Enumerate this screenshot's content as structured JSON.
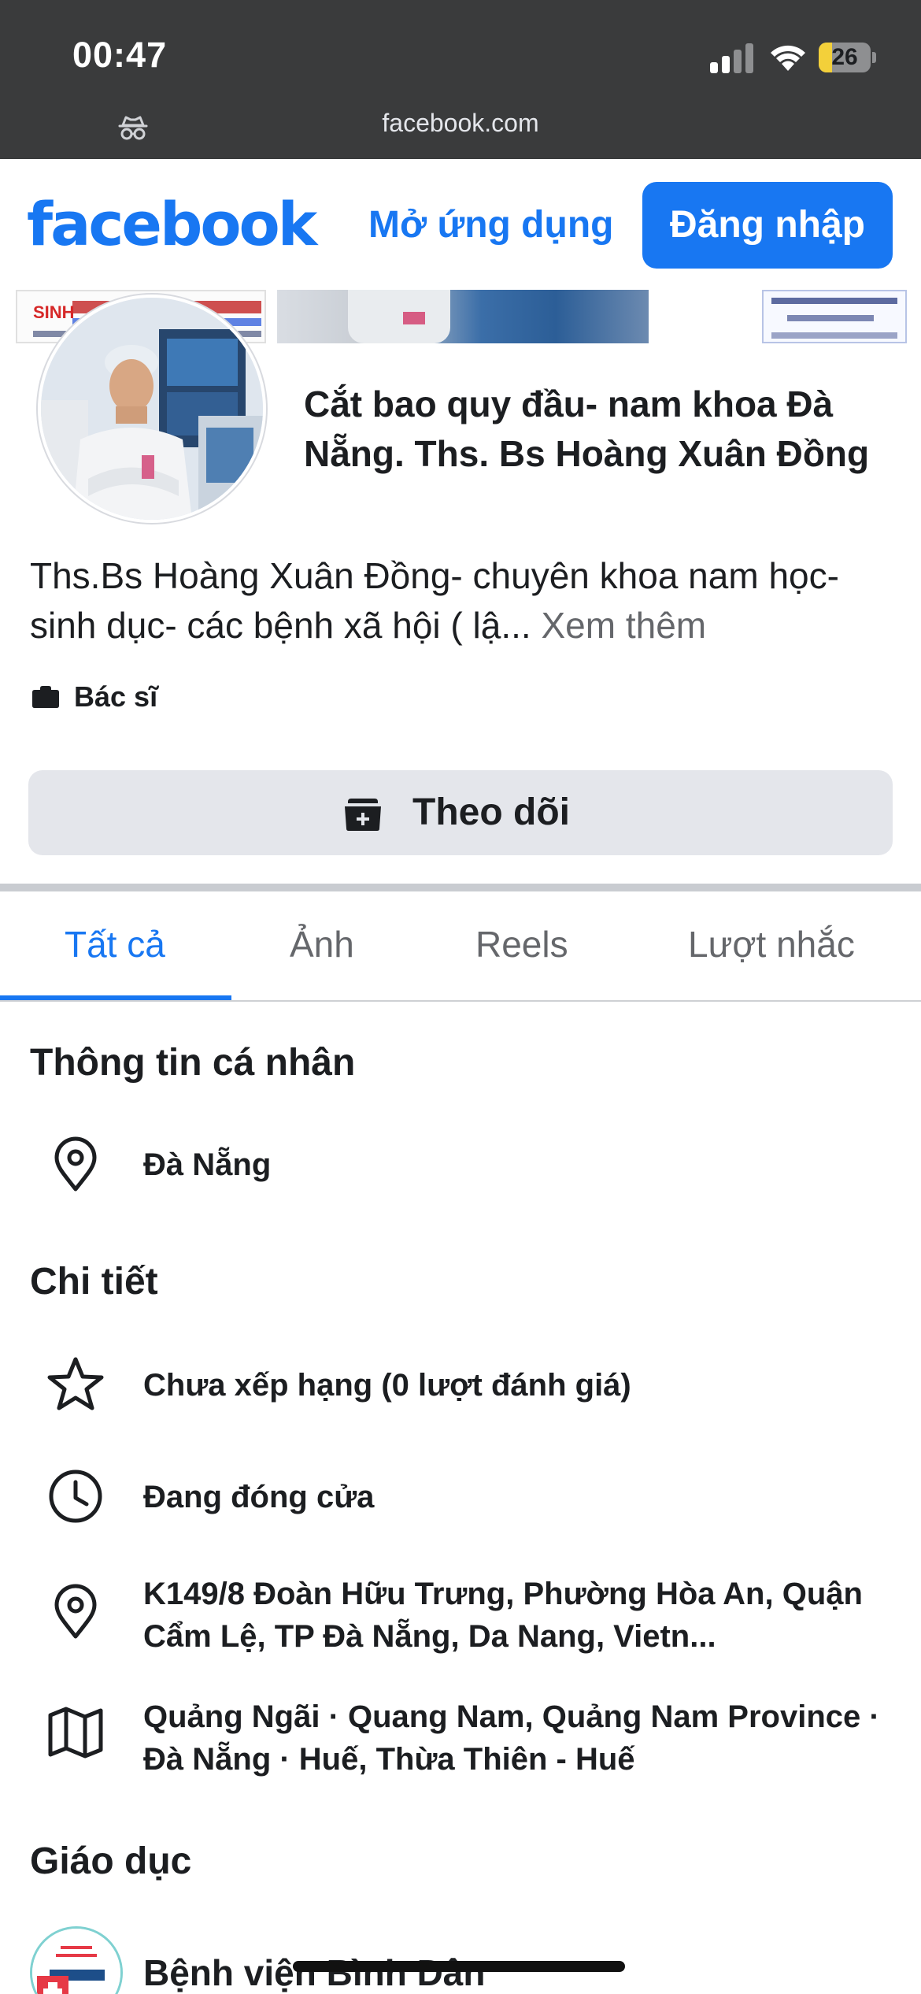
{
  "status_bar": {
    "time": "00:47",
    "battery_level": "26",
    "battery_fraction": 0.26,
    "icons": [
      "signal-icon",
      "wifi-icon",
      "battery-icon"
    ]
  },
  "browser": {
    "url": "facebook.com",
    "mode_icon": "incognito-icon"
  },
  "header": {
    "logo_text": "facebook",
    "open_app_label": "Mở ứng dụng",
    "login_label": "Đăng nhập"
  },
  "cover": {
    "left_text": "SINH"
  },
  "profile": {
    "name": "Cắt bao quy đầu- nam khoa Đà Nẵng. Ths. Bs Hoàng Xuân Đồng",
    "bio": "Ths.Bs  Hoàng Xuân Đồng- chuyên khoa nam học- sinh dục- các bệnh xã hội ( lậ...",
    "see_more": "Xem thêm",
    "category": "Bác sĩ",
    "follow_label": "Theo dõi"
  },
  "tabs": [
    {
      "label": "Tất cả",
      "active": true
    },
    {
      "label": "Ảnh",
      "active": false
    },
    {
      "label": "Reels",
      "active": false
    },
    {
      "label": "Lượt nhắc",
      "active": false
    }
  ],
  "personal_info": {
    "title": "Thông tin cá nhân",
    "location": "Đà Nẵng"
  },
  "details": {
    "title": "Chi tiết",
    "rating": "Chưa xếp hạng (0 lượt đánh giá)",
    "hours": "Đang đóng cửa",
    "address": "K149/8 Đoàn Hữu Trưng, Phường Hòa An, Quận Cẩm Lệ, TP Đà Nẵng, Da Nang, Vietn...",
    "service_area": "Quảng Ngãi · Quang Nam, Quảng Nam Province · Đà Nẵng · Huế, Thừa Thiên - Huế"
  },
  "education": {
    "title": "Giáo dục",
    "school": "Bệnh viện Bình Dân"
  },
  "colors": {
    "brand": "#1877f2",
    "status_bar_bg": "#3a3b3c",
    "button_gray": "#e4e6eb",
    "battery_fill": "#f3d03a"
  }
}
